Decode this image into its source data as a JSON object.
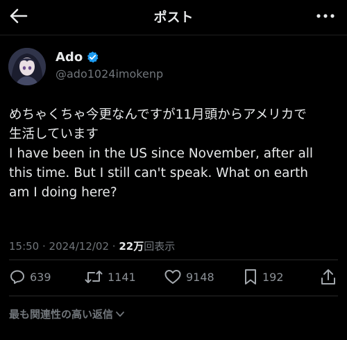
{
  "header": {
    "title": "ポスト",
    "back_icon": "arrow-left-icon",
    "more_icon": "more-horizontal-icon"
  },
  "author": {
    "display_name": "Ado",
    "handle": "@ado1024imokenp",
    "verified": true,
    "verified_color": "#1d9bf0"
  },
  "tweet": {
    "lines": [
      "めちゃくちゃ今更なんですが11月頭からアメリカで",
      "生活しています",
      "I have been in the US since November, after all",
      "this time. But I still can't speak. What on earth",
      "am I doing here?"
    ]
  },
  "meta": {
    "time": "15:50",
    "separator1": " · ",
    "date": "2024/12/02",
    "separator2": " · ",
    "views_count": "22万",
    "views_label": "回表示"
  },
  "actions": {
    "reply": {
      "icon": "reply-icon",
      "count": "639"
    },
    "repost": {
      "icon": "repost-icon",
      "count": "1141"
    },
    "like": {
      "icon": "heart-icon",
      "count": "9148"
    },
    "bookmark": {
      "icon": "bookmark-icon",
      "count": "192"
    },
    "share": {
      "icon": "share-icon"
    }
  },
  "replies_filter": {
    "label": "最も関連性の高い返信",
    "icon": "chevron-down-icon"
  }
}
